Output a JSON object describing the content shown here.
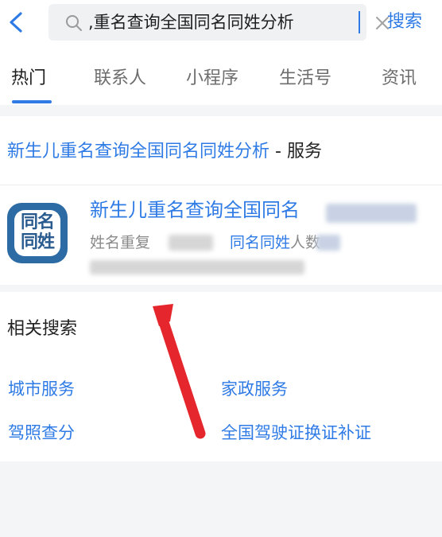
{
  "header": {
    "back_icon": "chevron-left-icon",
    "search_query": ",重名查询全国同名同姓分析",
    "search_icon": "search-icon",
    "clear_icon": "close-icon",
    "search_button": "搜索"
  },
  "tabs": [
    {
      "label": "热门",
      "active": true
    },
    {
      "label": "联系人",
      "active": false
    },
    {
      "label": "小程序",
      "active": false
    },
    {
      "label": "生活号",
      "active": false
    },
    {
      "label": "资讯",
      "active": false
    }
  ],
  "service": {
    "heading_query": "新生儿重名查询全国同名同姓分析",
    "heading_suffix": " - 服务",
    "app_icon_text_line1": "同名",
    "app_icon_text_line2": "同姓",
    "title": "新生儿重名查询全国同名",
    "desc_part1": "姓名重复",
    "desc_part2": "同名同姓",
    "desc_part3": "人数"
  },
  "related": {
    "title": "相关搜索",
    "items": [
      "城市服务",
      "家政服务",
      "驾照查分",
      "全国驾驶证换证补证"
    ]
  },
  "colors": {
    "accent": "#2f7be6",
    "annotation_arrow": "#e5262d",
    "app_icon_bg": "#2c6ba4"
  }
}
